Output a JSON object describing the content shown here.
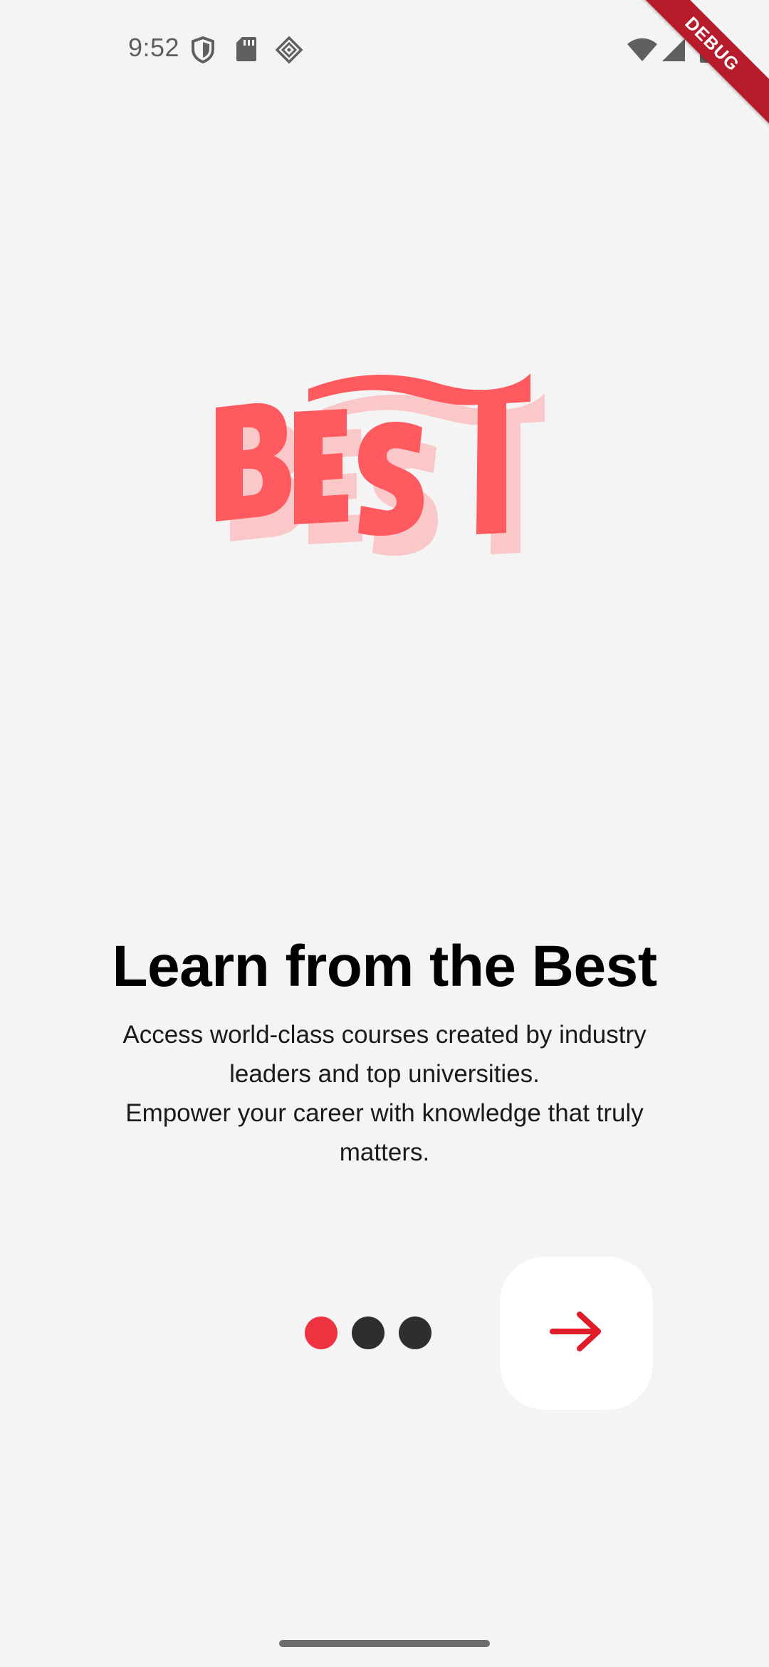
{
  "status_bar": {
    "time": "9:52",
    "icons": [
      "shield-icon",
      "sd-card-icon",
      "cast-diamond-icon",
      "wifi-icon",
      "cell-signal-icon",
      "battery-icon"
    ]
  },
  "debug_banner": {
    "label": "DEBUG",
    "color": "#b71c2d"
  },
  "logo": {
    "word": "BEST",
    "color": "#ff5a5f",
    "shadow_color": "#fbc8c9"
  },
  "onboarding": {
    "title": "Learn from the Best",
    "description_lines": [
      "Access world-class courses created by industry",
      "leaders and top universities.",
      "Empower your career with knowledge that truly",
      "matters."
    ],
    "page_indicator": {
      "current": 1,
      "total": 3,
      "active_color": "#ef3340",
      "inactive_color": "#2e2e2e"
    },
    "next_button": {
      "icon": "arrow-right-icon",
      "icon_color": "#e11b28"
    }
  }
}
